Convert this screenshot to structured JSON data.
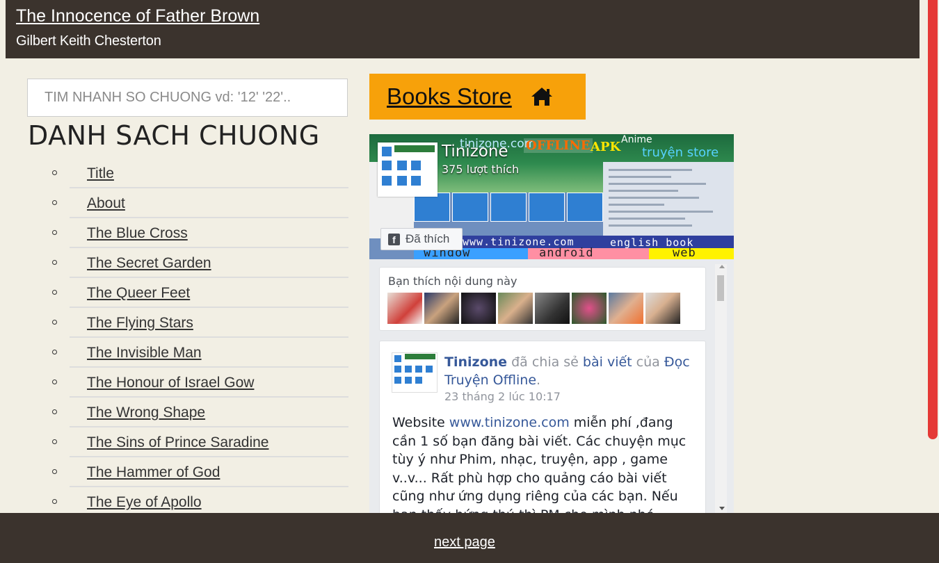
{
  "header": {
    "title": "The Innocence of Father Brown",
    "author": "Gilbert Keith Chesterton"
  },
  "search": {
    "placeholder": "TIM NHANH SO CHUONG vd: '12' '22'.."
  },
  "toc": {
    "heading": "DANH SACH CHUONG",
    "items": [
      "Title",
      "About",
      "The Blue Cross",
      "The Secret Garden",
      "The Queer Feet",
      "The Flying Stars",
      "The Invisible Man",
      "The Honour of Israel Gow",
      "The Wrong Shape",
      "The Sins of Prince Saradine",
      "The Hammer of God",
      "The Eye of Apollo"
    ]
  },
  "books_store": {
    "label": "Books Store",
    "icon": "home-icon",
    "color": "#f7a10a"
  },
  "facebook": {
    "page_name": "Tinizone",
    "likes": "375 lượt thích",
    "liked_button": "Đã thích",
    "cover": {
      "site": "tinizone.com",
      "offline": "OFFLINE",
      "apk": "APK",
      "anime": "Anime",
      "store": "truyện store",
      "url": "www.tinizone.com",
      "english": "english book",
      "window": "window",
      "android": "android",
      "web": "web"
    },
    "friends_label": "Bạn thích nội dung này",
    "post": {
      "author": "Tinizone",
      "shared": "đã chia sẻ",
      "link": "bài viết",
      "of": "của",
      "source": "Đọc Truyện Offline",
      "period": ".",
      "time": "23 tháng 2 lúc 10:17",
      "body_pre": "Website",
      "body_link": "www.tinizone.com",
      "body_text": "miễn phí ,đang cần 1 số bạn đăng bài viết. Các chuyện mục tùy ý như Phim, nhạc, truyện, app , game v..v... Rất phù hợp cho quảng cáo bài viết cũng như ứng dụng riêng của các bạn. Nếu bạn thấy hứng thú thì PM cho mình nhé"
    }
  },
  "footer": {
    "next": "next page"
  },
  "colors": {
    "header_bg": "#3b332d",
    "page_bg": "#f2efe4",
    "scroll_thumb": "#e53935",
    "fb_link": "#365899"
  }
}
